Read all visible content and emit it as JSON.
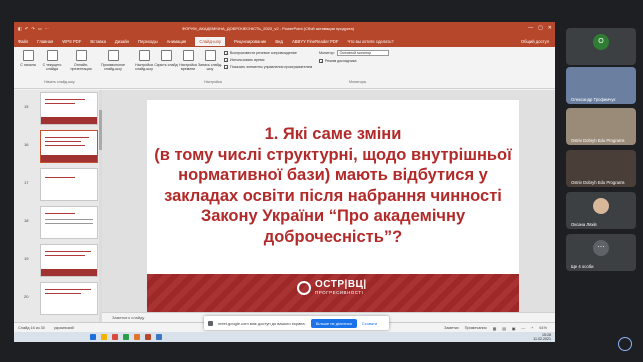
{
  "app": {
    "title": "ФОРУМ_АКАДЕМІЧНА_ДОБРОЧЕСНІСТЬ_2020_v2 - PowerPoint (Сбой активации продукта)",
    "quick_access": "◧ ↶ ↷ ▭ ⋯",
    "share_label": "Общий доступ"
  },
  "tabs": [
    "Файл",
    "Главная",
    "WPS PDF",
    "Вставка",
    "Дизайн",
    "Переходы",
    "Анимация",
    "Слайд-шоу",
    "Рецензирование",
    "Вид",
    "ABBYY FineReader PDF",
    "Что вы хотите сделать?"
  ],
  "active_tab": "Слайд-шоу",
  "ribbon": {
    "buttons": [
      "С начала",
      "С текущего слайда",
      "Онлайн-презентация",
      "Произвольное слайд-шоу",
      "Настройка слайд-шоу",
      "Скрыть слайд",
      "Настройка времени",
      "Запись слайд-шоу"
    ],
    "groups": [
      "Начать слайд-шоу",
      "Настройка",
      "Мониторы"
    ],
    "checks": [
      "Воспроизвести речевое сопровождение",
      "Использовать время",
      "Показать элементы управления проигрывателем"
    ],
    "monitor_label": "Монитор:",
    "monitor_value": "Основной монитор",
    "presenter_view": "Режим докладчика"
  },
  "thumbnails": [
    {
      "num": "15",
      "selected": false
    },
    {
      "num": "16",
      "selected": true
    },
    {
      "num": "17",
      "selected": false
    },
    {
      "num": "18",
      "selected": false
    },
    {
      "num": "19",
      "selected": false
    },
    {
      "num": "20",
      "selected": false
    }
  ],
  "slide": {
    "heading_lines": [
      "1. Які саме зміни",
      "(в тому числі структурні, щодо внутрішньої",
      "нормативної бази) мають відбутися у",
      "закладах освіти після набрання чинності",
      "Закону України “Про академічну",
      "доброчесність”?"
    ],
    "logo_main": "ОСТР|ВЦ|",
    "logo_sub": "ПРОГРЕСИВНОСТІ"
  },
  "notes_placeholder": "Заметки к слайду",
  "status": {
    "slide_info": "Слайд 16 из 30",
    "language": "украинский",
    "right": [
      "Заметки",
      "Примечания",
      "▦",
      "▤",
      "▣",
      "—",
      "+",
      "61%"
    ]
  },
  "toast": {
    "text": "meet.google.com має доступ до вашого екрана.",
    "primary": "Більше не ділитися",
    "secondary": "Сховати"
  },
  "taskbar": {
    "time": "15:28",
    "date": "11.02.2021",
    "icon_colors": [
      "#1e6fd9",
      "#f0b400",
      "#d84b3c",
      "#2a9d4b",
      "#e0762a",
      "#b7472a",
      "#3a76c4"
    ]
  },
  "participants": [
    {
      "name": "",
      "initial": "O",
      "color": "#2e7d32",
      "type": "avatar"
    },
    {
      "name": "Олександр Трофимчук",
      "initial": "",
      "color": "#6b7fa0",
      "type": "video"
    },
    {
      "name": "Ostriv Dobryh Edu Programs",
      "initial": "",
      "color": "#9a8a78",
      "type": "video"
    },
    {
      "name": "Ostriv Dobryh Edu Programs",
      "initial": "",
      "color": "#4a3f38",
      "type": "video"
    },
    {
      "name": "Оксана Ляхів",
      "initial": "",
      "color": "#3c4043",
      "type": "avatar-img"
    },
    {
      "name": "Ще 4 особи",
      "initial": "⋯",
      "color": "#3c4043",
      "type": "more"
    }
  ]
}
